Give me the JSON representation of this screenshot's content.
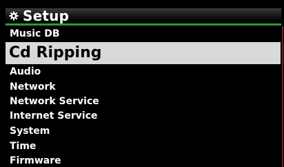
{
  "header": {
    "title": "Setup",
    "icon": "gear-icon"
  },
  "menu": {
    "selected_index": 1,
    "items": [
      {
        "label": "Music DB"
      },
      {
        "label": "Cd Ripping"
      },
      {
        "label": "Audio"
      },
      {
        "label": "Network"
      },
      {
        "label": "Network Service"
      },
      {
        "label": "Internet Service"
      },
      {
        "label": "System"
      },
      {
        "label": "Time"
      },
      {
        "label": "Firmware"
      }
    ]
  },
  "colors": {
    "background": "#000000",
    "title_underline": "#2f9a3b",
    "selection_highlight": "#d9d9d9",
    "text": "#ffffff",
    "selected_text": "#000000",
    "right_edge": "#6e1f2e"
  }
}
